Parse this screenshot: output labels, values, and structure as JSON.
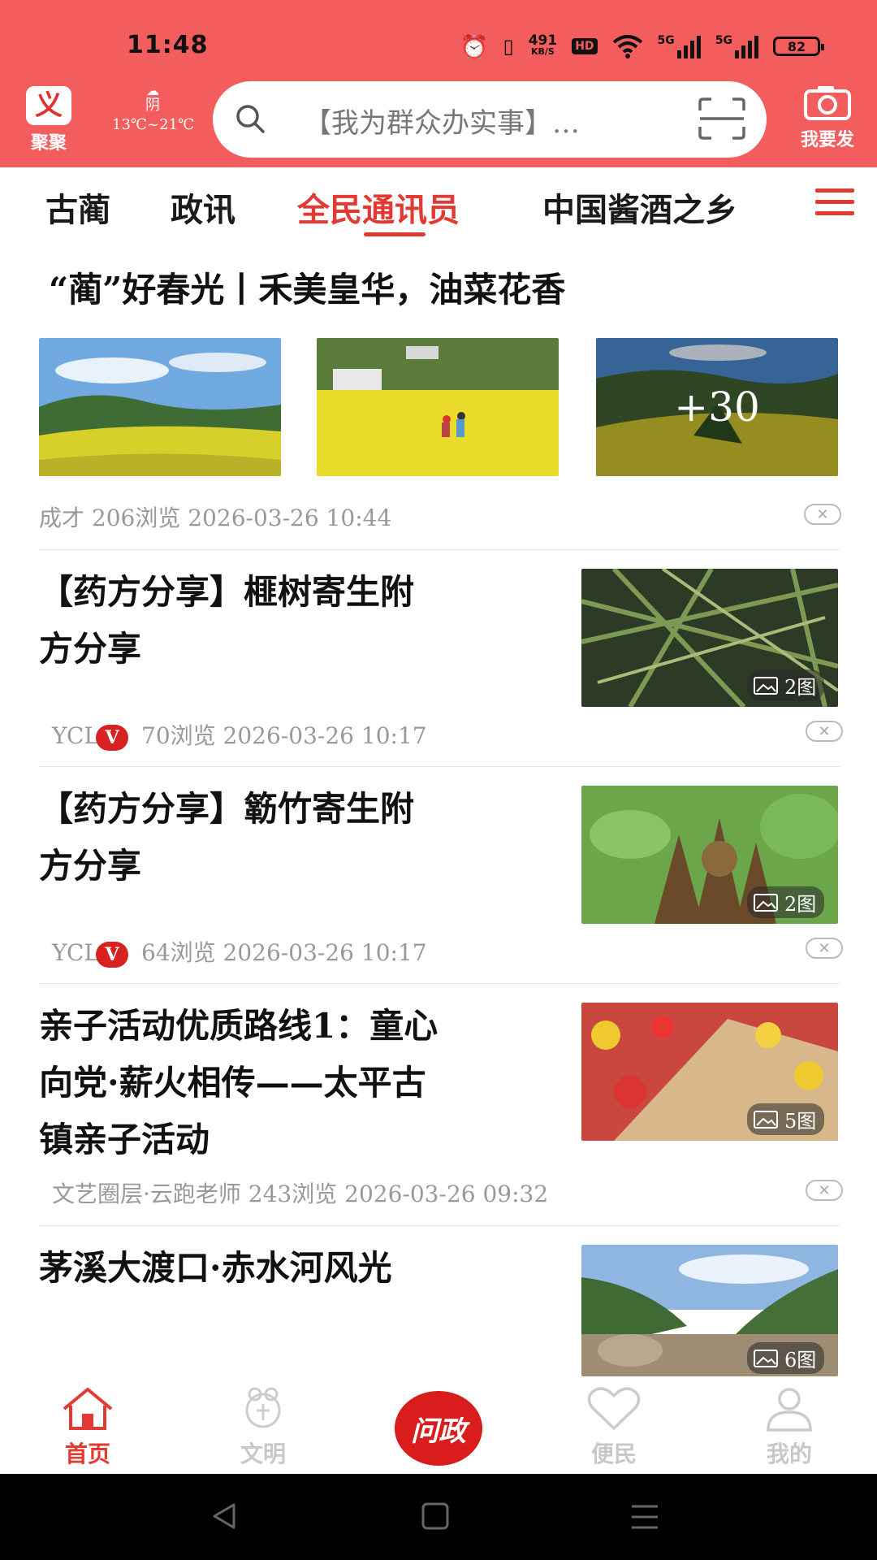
{
  "status_bar": {
    "time": "11:48",
    "net_speed": "491",
    "net_unit": "KB/S",
    "hd": "HD",
    "sig1": "5G",
    "sig2": "5G",
    "battery": "82"
  },
  "header": {
    "logo_text": "聚聚",
    "weather_condition": "阴",
    "weather_temp": "13℃~21℃",
    "search_placeholder": "【我为群众办实事】…",
    "camera_label": "我要发"
  },
  "tabs": [
    {
      "label": "古蔺"
    },
    {
      "label": "政讯"
    },
    {
      "label": "全民通讯员",
      "active": true
    },
    {
      "label": "中国酱酒之乡"
    }
  ],
  "articles": [
    {
      "title": "“蔺”好春光丨禾美皇华，油菜花香",
      "meta": "成才  206浏览 2026-03-26 10:44",
      "more_images": "+30"
    },
    {
      "title_line1": "【药方分享】榧树寄生附",
      "title_line2": "方分享",
      "author": "YCL",
      "badge": "V",
      "stats": "70浏览 2026-03-26 10:17",
      "img_count": "2图"
    },
    {
      "title_line1": "【药方分享】簕竹寄生附",
      "title_line2": "方分享",
      "author": "YCL",
      "badge": "V",
      "stats": "64浏览 2026-03-26 10:17",
      "img_count": "2图"
    },
    {
      "title_line1": "亲子活动优质路线1：童心",
      "title_line2": "向党·薪火相传——太平古",
      "title_line3": "镇亲子活动",
      "meta": "文艺圈层·云跑老师  243浏览 2026-03-26 09:32",
      "img_count": "5图"
    },
    {
      "title_line1": "茅溪大渡口·赤水河风光",
      "img_count": "6图"
    }
  ],
  "bottom_nav": {
    "home": "首页",
    "civil": "文明",
    "center": "问政",
    "service": "便民",
    "mine": "我的"
  },
  "colors": {
    "brand": "#f45d5d",
    "accent": "#e23a33"
  }
}
